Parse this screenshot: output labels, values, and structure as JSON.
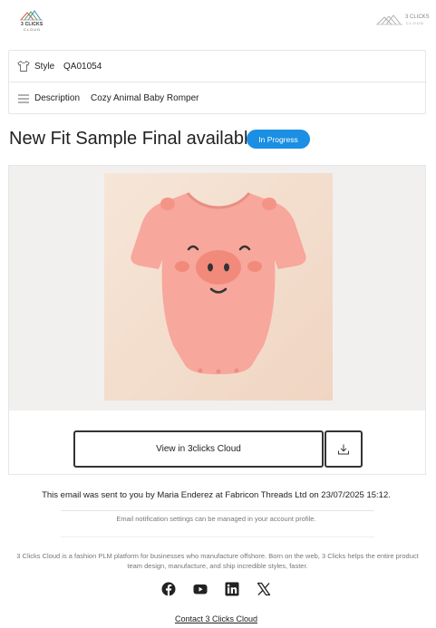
{
  "header": {
    "logo_left_line1": "3 CLICKS",
    "logo_left_line2": "CLOUD",
    "logo_right_line1": "3 CLICKS",
    "logo_right_line2": "CLOUD"
  },
  "info": {
    "style_label": "Style",
    "style_value": "QA01054",
    "description_label": "Description",
    "description_value": "Cozy Animal Baby Romper"
  },
  "main": {
    "title": "New Fit Sample Final available",
    "status_badge": "In Progress",
    "image_alt": "Pink pig baby romper",
    "view_button": "View in 3clicks Cloud"
  },
  "footer": {
    "sent_text": "This email was sent to you by Maria Enderez at Fabricon Threads Ltd on 23/07/2025 15:12.",
    "notification_text": "Email notification settings can be managed in your account profile.",
    "about_text": "3 Clicks Cloud is a fashion PLM platform for businesses who manufacture offshore. Born on the web, 3 Clicks helps the entire product team design, manufacture, and ship incredible styles, faster.",
    "contact_link": "Contact 3 Clicks Cloud",
    "social_icons": [
      "facebook-icon",
      "youtube-icon",
      "linkedin-icon",
      "x-icon"
    ]
  },
  "colors": {
    "badge_bg": "#1a8fe3",
    "image_bg": "#f1f0ef",
    "romper": "#f7a79b"
  }
}
